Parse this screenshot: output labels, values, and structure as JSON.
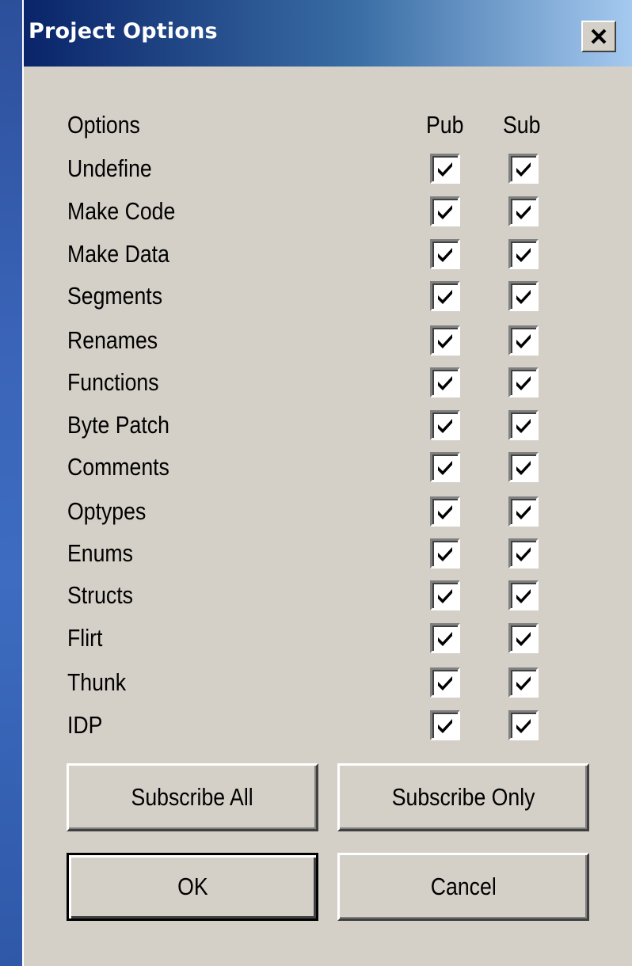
{
  "window": {
    "title": "Project Options",
    "close_symbol": "X"
  },
  "columns": {
    "options": "Options",
    "pub": "Pub",
    "sub": "Sub"
  },
  "options": [
    {
      "label": "Undefine",
      "pub": true,
      "sub": true
    },
    {
      "label": "Make Code",
      "pub": true,
      "sub": true
    },
    {
      "label": "Make Data",
      "pub": true,
      "sub": true
    },
    {
      "label": "Segments",
      "pub": true,
      "sub": true
    },
    {
      "label": "Renames",
      "pub": true,
      "sub": true
    },
    {
      "label": "Functions",
      "pub": true,
      "sub": true
    },
    {
      "label": "Byte Patch",
      "pub": true,
      "sub": true
    },
    {
      "label": "Comments",
      "pub": true,
      "sub": true
    },
    {
      "label": "Optypes",
      "pub": true,
      "sub": true
    },
    {
      "label": "Enums",
      "pub": true,
      "sub": true
    },
    {
      "label": "Structs",
      "pub": true,
      "sub": true
    },
    {
      "label": "Flirt",
      "pub": true,
      "sub": true
    },
    {
      "label": "Thunk",
      "pub": true,
      "sub": true
    },
    {
      "label": "IDP",
      "pub": true,
      "sub": true
    }
  ],
  "buttons": {
    "subscribe_all": "Subscribe All",
    "subscribe_only": "Subscribe Only",
    "ok": "OK",
    "cancel": "Cancel"
  },
  "colors": {
    "dialog_bg": "#d4d0c8",
    "titlebar_start": "#0a246a",
    "titlebar_end": "#a6caf0"
  }
}
